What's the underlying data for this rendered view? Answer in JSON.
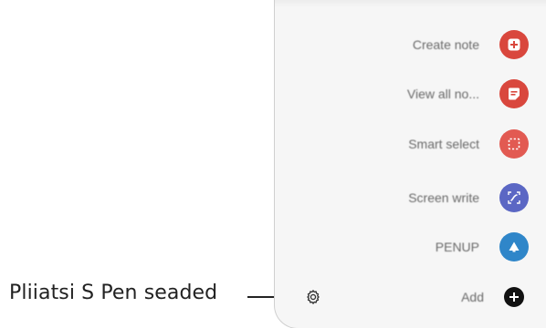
{
  "callout": {
    "label": "Pliiatsi S Pen seaded"
  },
  "menu": {
    "items": [
      {
        "label": "Create note",
        "icon": "create-note-icon",
        "color": "#d9473d"
      },
      {
        "label": "View all no...",
        "icon": "view-all-notes-icon",
        "color": "#d9473d"
      },
      {
        "label": "Smart select",
        "icon": "smart-select-icon",
        "color": "#e25a52"
      },
      {
        "label": "Screen write",
        "icon": "screen-write-icon",
        "color": "#5b67c4"
      },
      {
        "label": "PENUP",
        "icon": "penup-icon",
        "color": "#2f86c9"
      },
      {
        "label": "Add",
        "icon": "add-icon",
        "color": "#111111"
      }
    ]
  },
  "settings": {
    "icon": "gear-icon"
  }
}
